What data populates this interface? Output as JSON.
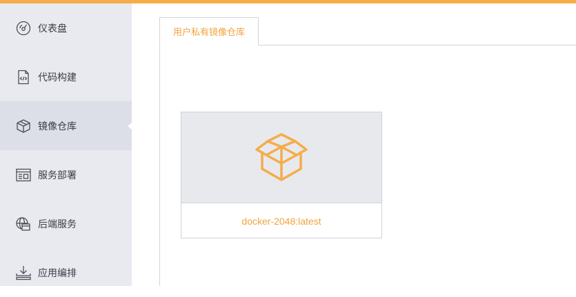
{
  "colors": {
    "accent": "#f5ac49",
    "sidebar_bg": "#e8eaf0",
    "sidebar_active_bg": "#dcdfe7",
    "text": "#3a3d45"
  },
  "sidebar": {
    "items": [
      {
        "label": "仪表盘",
        "icon": "dashboard-gauge-icon",
        "active": false
      },
      {
        "label": "代码构建",
        "icon": "code-file-icon",
        "active": false
      },
      {
        "label": "镜像仓库",
        "icon": "cube-box-icon",
        "active": true
      },
      {
        "label": "服务部署",
        "icon": "server-window-icon",
        "active": false
      },
      {
        "label": "后端服务",
        "icon": "globe-window-icon",
        "active": false
      },
      {
        "label": "应用编排",
        "icon": "download-tray-icon",
        "active": false
      }
    ]
  },
  "main": {
    "tabs": [
      {
        "label": "用户私有镜像仓库",
        "active": true
      }
    ],
    "images": [
      {
        "name": "docker-2048:latest",
        "icon": "open-box-icon"
      }
    ]
  }
}
